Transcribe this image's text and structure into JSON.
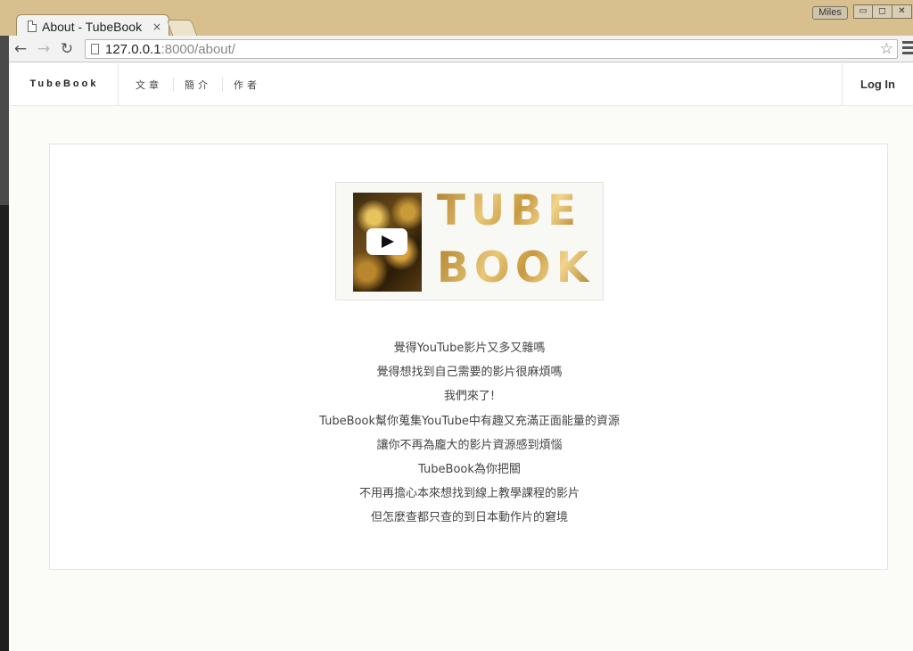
{
  "browser": {
    "tab_title": "About - TubeBook",
    "tab_close": "×",
    "user_name": "Miles",
    "url_host": "127.0.0.1",
    "url_path": ":8000/about/",
    "window_controls": [
      "▭",
      "◻",
      "✕"
    ]
  },
  "site": {
    "brand": "TubeBook",
    "menu": [
      "文章",
      "簡介",
      "作者"
    ],
    "login": "Log In"
  },
  "logo": {
    "line1": "TUBE",
    "line2": "BOOK"
  },
  "about_lines": [
    "覺得YouTube影片又多又雜嗎",
    "覺得想找到自己需要的影片很麻煩嗎",
    "我們來了!",
    "TubeBook幫你蒐集YouTube中有趣又充滿正面能量的資源",
    "讓你不再為龐大的影片資源感到煩惱",
    "TubeBook為你把關",
    "不用再擔心本來想找到線上教學課程的影片",
    "但怎麼查都只查的到日本動作片的窘境"
  ],
  "icons": {
    "page": "document-icon",
    "back": "back-arrow-icon",
    "forward": "forward-arrow-icon",
    "reload": "reload-icon",
    "bookmark": "star-icon",
    "menu": "hamburger-menu-icon",
    "play": "play-icon"
  }
}
